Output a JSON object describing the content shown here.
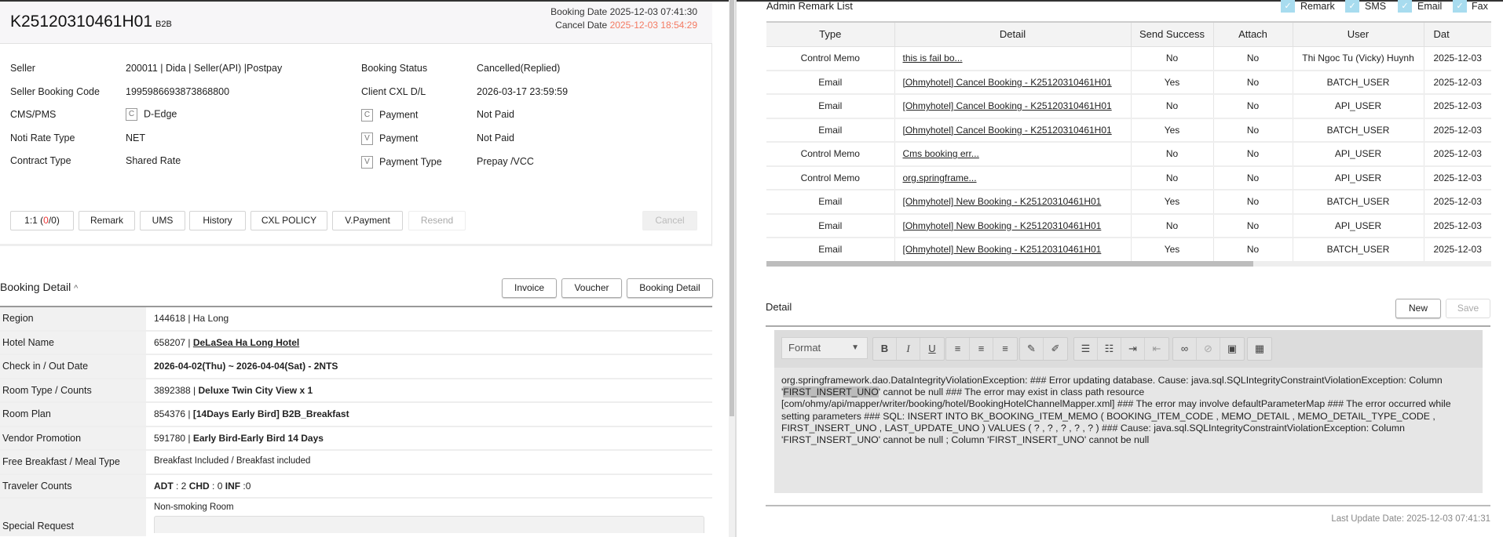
{
  "booking": {
    "code": "K25120310461H01",
    "channel": "B2B",
    "booking_date_label": "Booking Date",
    "booking_date": "2025-12-03 07:41:30",
    "cancel_date_label": "Cancel Date",
    "cancel_date": "2025-12-03 18:54:29"
  },
  "info": {
    "left": [
      {
        "label": "Seller",
        "value": "200011 | Dida | Seller(API) |Postpay"
      },
      {
        "label": "Seller Booking Code",
        "value": "1995986693873868800"
      },
      {
        "label": "CMS/PMS",
        "box": "C",
        "value": "D-Edge"
      },
      {
        "label": "Noti Rate Type",
        "value": "NET"
      },
      {
        "label": "Contract Type",
        "value": "Shared Rate"
      }
    ],
    "right": [
      {
        "label": "Booking Status",
        "value": "Cancelled(Replied)"
      },
      {
        "label": "Client CXL D/L",
        "value": "2026-03-17 23:59:59"
      },
      {
        "box": "C",
        "label": "Payment",
        "value": "Not Paid"
      },
      {
        "box": "V",
        "label": "Payment",
        "value": "Not Paid"
      },
      {
        "box": "V",
        "label": "Payment Type",
        "value": "Prepay /VCC"
      }
    ]
  },
  "actions": {
    "one_to_one_prefix": "1:1 (",
    "one_to_one_red": "0",
    "one_to_one_suffix": "/0)",
    "remark": "Remark",
    "ums": "UMS",
    "history": "History",
    "cxl_policy": "CXL POLICY",
    "vpayment": "V.Payment",
    "resend": "Resend",
    "cancel": "Cancel"
  },
  "booking_detail": {
    "title": "Booking Detail",
    "invoice": "Invoice",
    "voucher": "Voucher",
    "detail_button": "Booking Detail",
    "rows": {
      "region": {
        "label": "Region",
        "code": "144618",
        "value": "Ha Long"
      },
      "hotel": {
        "label": "Hotel Name",
        "code": "658207",
        "value": "DeLaSea Ha Long Hotel"
      },
      "dates": {
        "label": "Check in / Out Date",
        "value": "2026-04-02(Thu) ~ 2026-04-04(Sat) - 2NTS"
      },
      "room": {
        "label": "Room Type / Counts",
        "code": "3892388",
        "value": "Deluxe Twin City View x 1"
      },
      "plan": {
        "label": "Room Plan",
        "code": "854376",
        "value": "[14Days Early Bird] B2B_Breakfast"
      },
      "promo": {
        "label": "Vendor Promotion",
        "code": "591780",
        "value": "Early Bird-Early Bird 14 Days"
      },
      "meal": {
        "label": "Free Breakfast / Meal Type",
        "value": "Breakfast Included / Breakfast included"
      },
      "travelers": {
        "label": "Traveler Counts",
        "adt_label": "ADT",
        "adt": ": 2",
        "chd_label": "CHD",
        "chd": ": 0",
        "inf_label": "INF",
        "inf": ":0"
      },
      "special": {
        "label": "Special Request",
        "value": "Non-smoking Room"
      }
    }
  },
  "remark_list": {
    "title": "Admin Remark List",
    "filters": [
      "Remark",
      "SMS",
      "Email",
      "Fax"
    ],
    "columns": [
      "Type",
      "Detail",
      "Send Success",
      "Attach",
      "User",
      "Dat"
    ],
    "rows": [
      [
        "Control Memo",
        "this is fail bo...",
        "No",
        "No",
        "Thi Ngoc Tu (Vicky) Huynh",
        "2025-12-03"
      ],
      [
        "Email",
        "[Ohmyhotel] Cancel Booking - K25120310461H01",
        "Yes",
        "No",
        "BATCH_USER",
        "2025-12-03"
      ],
      [
        "Email",
        "[Ohmyhotel] Cancel Booking - K25120310461H01",
        "No",
        "No",
        "API_USER",
        "2025-12-03"
      ],
      [
        "Email",
        "[Ohmyhotel] Cancel Booking - K25120310461H01",
        "Yes",
        "No",
        "BATCH_USER",
        "2025-12-03"
      ],
      [
        "Control Memo",
        "Cms booking err...",
        "No",
        "No",
        "API_USER",
        "2025-12-03"
      ],
      [
        "Control Memo",
        "org.springframe...",
        "No",
        "No",
        "API_USER",
        "2025-12-03"
      ],
      [
        "Email",
        "[Ohmyhotel] New Booking - K25120310461H01",
        "Yes",
        "No",
        "BATCH_USER",
        "2025-12-03"
      ],
      [
        "Email",
        "[Ohmyhotel] New Booking - K25120310461H01",
        "No",
        "No",
        "API_USER",
        "2025-12-03"
      ],
      [
        "Email",
        "[Ohmyhotel] New Booking - K25120310461H01",
        "Yes",
        "No",
        "BATCH_USER",
        "2025-12-03"
      ]
    ]
  },
  "detail": {
    "title": "Detail",
    "new": "New",
    "save": "Save",
    "format": "Format",
    "content_1": "org.springframework.dao.DataIntegrityViolationException: ### Error updating database. Cause: java.sql.SQLIntegrityConstraintViolationException: Column '",
    "content_hl": "FIRST_INSERT_UNO",
    "content_2": "' cannot be null ### The error may exist in class path resource [com/ohmy/api/mapper/writer/booking/hotel/BookingHotelChannelMapper.xml] ### The error may involve defaultParameterMap ### The error occurred while setting parameters ### SQL: INSERT INTO BK_BOOKING_ITEM_MEMO ( BOOKING_ITEM_CODE , MEMO_DETAIL , MEMO_DETAIL_TYPE_CODE , FIRST_INSERT_UNO , LAST_UPDATE_UNO ) VALUES ( ? , ? , ? , ? , ? ) ### Cause: java.sql.SQLIntegrityConstraintViolationException: Column 'FIRST_INSERT_UNO' cannot be null ; Column 'FIRST_INSERT_UNO' cannot be null",
    "last_update": "Last Update Date: 2025-12-03 07:41:31"
  },
  "colors": {
    "cancel_date": "#f47a62",
    "checkbox": "#a8dcef"
  }
}
